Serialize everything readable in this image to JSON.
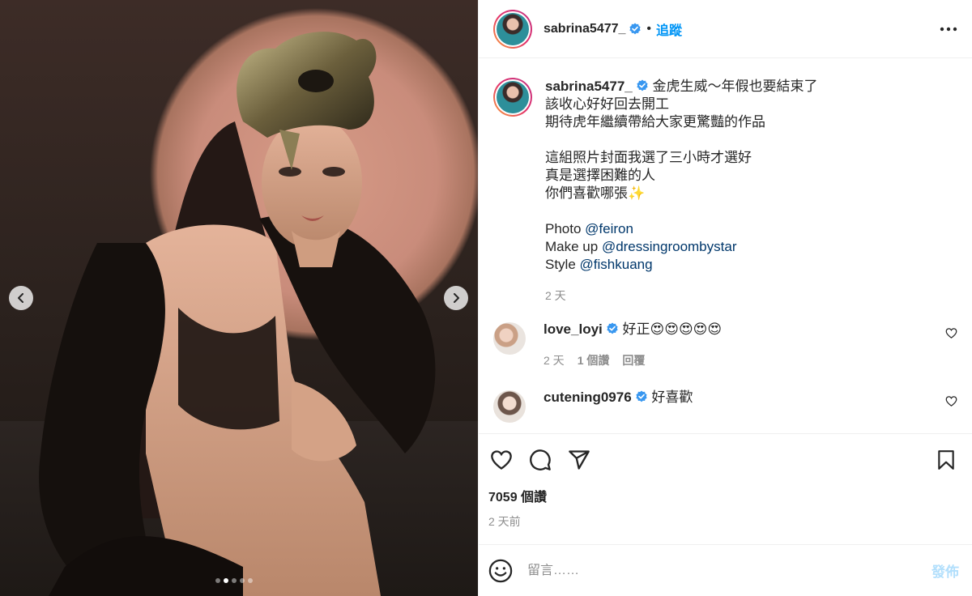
{
  "post": {
    "username": "sabrina5477_",
    "follow_label": "追蹤",
    "separator": "•",
    "caption": {
      "lines": [
        "金虎生威～年假也要結束了",
        "該收心好好回去開工",
        "期待虎年繼續帶給大家更驚豔的作品",
        "",
        "這組照片封面我選了三小時才選好",
        "真是選擇困難的人",
        "你們喜歡哪張✨",
        ""
      ],
      "credits": [
        {
          "label": "Photo ",
          "mention": "@feiron"
        },
        {
          "label": "Make up ",
          "mention": "@dressingroombystar"
        },
        {
          "label": "Style ",
          "mention": "@fishkuang"
        }
      ],
      "time": "2 天"
    },
    "comments": [
      {
        "username": "love_loyi",
        "text": "好正😍😍😍😍😍",
        "time": "2 天",
        "likes": "1 個讚",
        "reply": "回覆"
      },
      {
        "username": "cutening0976",
        "text": "好喜歡",
        "time": "",
        "likes": "",
        "reply": ""
      }
    ],
    "likes_count": "7059 個讚",
    "posted_ago": "2 天前",
    "comment_placeholder": "留言……",
    "post_label": "發佈",
    "carousel": {
      "total": 5,
      "active": 2
    }
  },
  "colors": {
    "accent": "#0095f6",
    "verified": "#3897f0",
    "mention": "#00376b",
    "muted": "#8e8e8e"
  },
  "icons": [
    "chevron-left-icon",
    "chevron-right-icon",
    "verified-icon",
    "more-icon",
    "heart-icon",
    "comment-icon",
    "share-icon",
    "bookmark-icon",
    "emoji-icon"
  ]
}
